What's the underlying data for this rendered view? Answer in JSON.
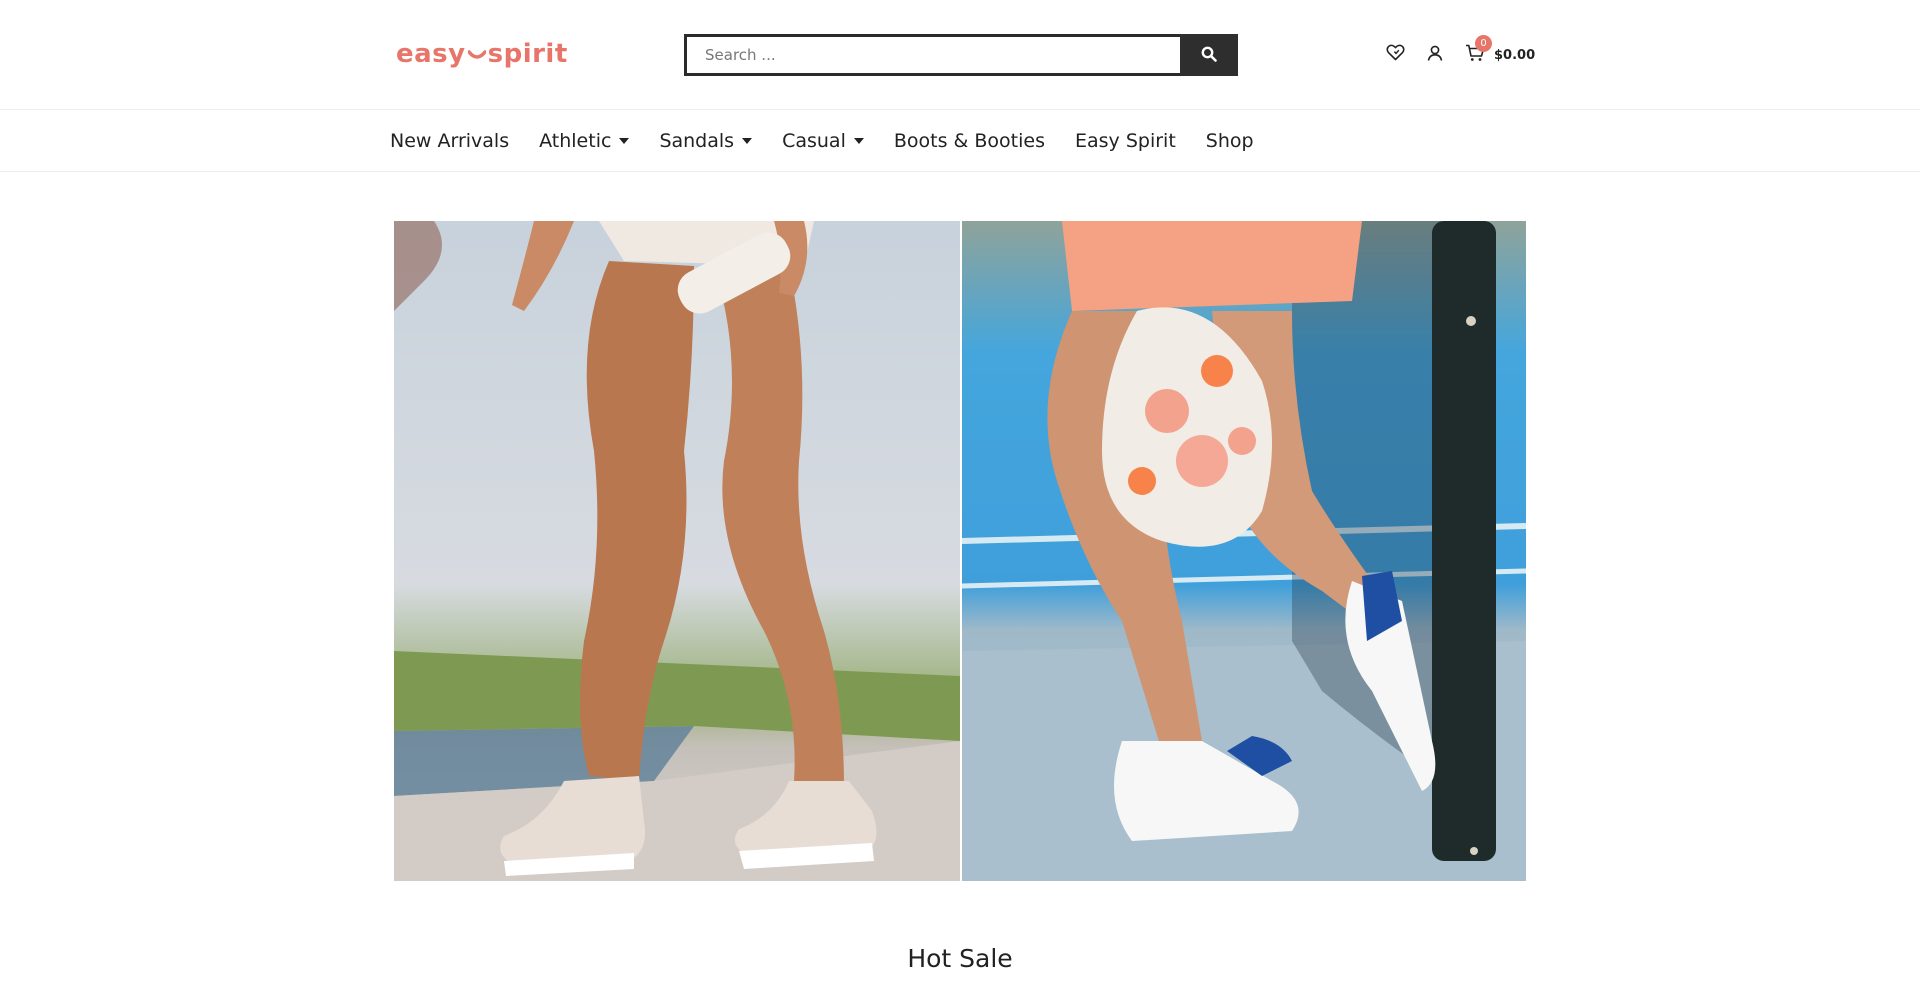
{
  "brand": {
    "logo_left": "easy",
    "logo_right": "spirit",
    "accent_color": "#e8756a"
  },
  "search": {
    "placeholder": "Search ...",
    "button_icon": "search-icon"
  },
  "header": {
    "wishlist_icon": "heart-icon",
    "account_icon": "user-icon",
    "cart_icon": "cart-icon",
    "cart_count": "0",
    "cart_total": "$0.00"
  },
  "nav": {
    "items": [
      {
        "label": "New Arrivals",
        "has_dropdown": false
      },
      {
        "label": "Athletic",
        "has_dropdown": true
      },
      {
        "label": "Sandals",
        "has_dropdown": true
      },
      {
        "label": "Casual",
        "has_dropdown": true
      },
      {
        "label": "Boots & Booties",
        "has_dropdown": false
      },
      {
        "label": "Easy Spirit",
        "has_dropdown": false
      },
      {
        "label": "Shop",
        "has_dropdown": false
      }
    ]
  },
  "section": {
    "title": "Hot Sale"
  }
}
